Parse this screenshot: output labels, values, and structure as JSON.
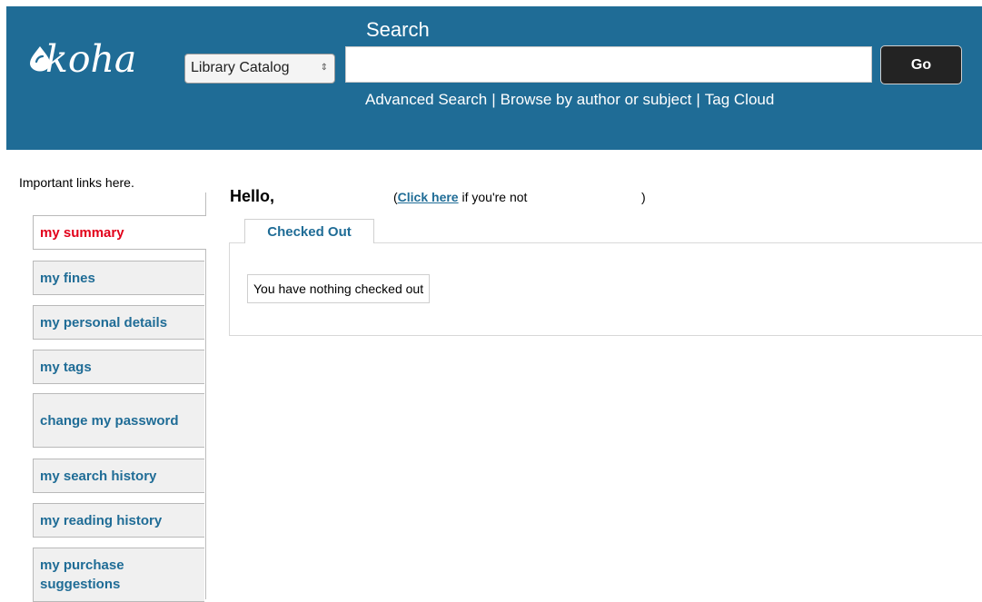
{
  "header": {
    "logo_text": "koha",
    "search_heading": "Search",
    "catalog_select": "Library Catalog",
    "search_value": "",
    "go_label": "Go",
    "links": [
      "Advanced Search",
      "Browse by author or subject",
      "Tag Cloud"
    ],
    "background_color": "#1f6c96"
  },
  "sidebar": {
    "intro": "Important links here.",
    "items": [
      {
        "label": "my summary",
        "active": true
      },
      {
        "label": "my fines",
        "active": false
      },
      {
        "label": "my personal details",
        "active": false
      },
      {
        "label": "my tags",
        "active": false
      },
      {
        "label": "change my password",
        "active": false
      },
      {
        "label": "my search history",
        "active": false
      },
      {
        "label": "my reading history",
        "active": false
      },
      {
        "label": "my purchase suggestions",
        "active": false
      }
    ],
    "active_color": "#e2001a",
    "link_color": "#1f6c96"
  },
  "main": {
    "greeting": "Hello,",
    "not_you_open": "(",
    "not_you_link": "Click here",
    "not_you_text": " if you're not",
    "not_you_close": ")",
    "tabs": [
      {
        "label": "Checked Out"
      }
    ],
    "empty_message": "You have nothing checked out"
  }
}
